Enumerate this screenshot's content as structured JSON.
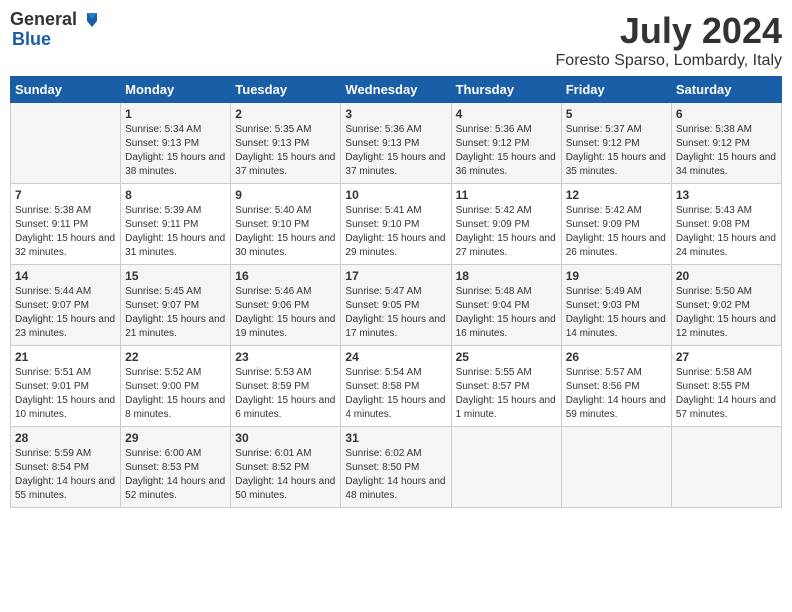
{
  "header": {
    "logo_general": "General",
    "logo_blue": "Blue",
    "month_title": "July 2024",
    "location": "Foresto Sparso, Lombardy, Italy"
  },
  "columns": [
    "Sunday",
    "Monday",
    "Tuesday",
    "Wednesday",
    "Thursday",
    "Friday",
    "Saturday"
  ],
  "weeks": [
    [
      {
        "day": "",
        "sunrise": "",
        "sunset": "",
        "daylight": ""
      },
      {
        "day": "1",
        "sunrise": "Sunrise: 5:34 AM",
        "sunset": "Sunset: 9:13 PM",
        "daylight": "Daylight: 15 hours and 38 minutes."
      },
      {
        "day": "2",
        "sunrise": "Sunrise: 5:35 AM",
        "sunset": "Sunset: 9:13 PM",
        "daylight": "Daylight: 15 hours and 37 minutes."
      },
      {
        "day": "3",
        "sunrise": "Sunrise: 5:36 AM",
        "sunset": "Sunset: 9:13 PM",
        "daylight": "Daylight: 15 hours and 37 minutes."
      },
      {
        "day": "4",
        "sunrise": "Sunrise: 5:36 AM",
        "sunset": "Sunset: 9:12 PM",
        "daylight": "Daylight: 15 hours and 36 minutes."
      },
      {
        "day": "5",
        "sunrise": "Sunrise: 5:37 AM",
        "sunset": "Sunset: 9:12 PM",
        "daylight": "Daylight: 15 hours and 35 minutes."
      },
      {
        "day": "6",
        "sunrise": "Sunrise: 5:38 AM",
        "sunset": "Sunset: 9:12 PM",
        "daylight": "Daylight: 15 hours and 34 minutes."
      }
    ],
    [
      {
        "day": "7",
        "sunrise": "Sunrise: 5:38 AM",
        "sunset": "Sunset: 9:11 PM",
        "daylight": "Daylight: 15 hours and 32 minutes."
      },
      {
        "day": "8",
        "sunrise": "Sunrise: 5:39 AM",
        "sunset": "Sunset: 9:11 PM",
        "daylight": "Daylight: 15 hours and 31 minutes."
      },
      {
        "day": "9",
        "sunrise": "Sunrise: 5:40 AM",
        "sunset": "Sunset: 9:10 PM",
        "daylight": "Daylight: 15 hours and 30 minutes."
      },
      {
        "day": "10",
        "sunrise": "Sunrise: 5:41 AM",
        "sunset": "Sunset: 9:10 PM",
        "daylight": "Daylight: 15 hours and 29 minutes."
      },
      {
        "day": "11",
        "sunrise": "Sunrise: 5:42 AM",
        "sunset": "Sunset: 9:09 PM",
        "daylight": "Daylight: 15 hours and 27 minutes."
      },
      {
        "day": "12",
        "sunrise": "Sunrise: 5:42 AM",
        "sunset": "Sunset: 9:09 PM",
        "daylight": "Daylight: 15 hours and 26 minutes."
      },
      {
        "day": "13",
        "sunrise": "Sunrise: 5:43 AM",
        "sunset": "Sunset: 9:08 PM",
        "daylight": "Daylight: 15 hours and 24 minutes."
      }
    ],
    [
      {
        "day": "14",
        "sunrise": "Sunrise: 5:44 AM",
        "sunset": "Sunset: 9:07 PM",
        "daylight": "Daylight: 15 hours and 23 minutes."
      },
      {
        "day": "15",
        "sunrise": "Sunrise: 5:45 AM",
        "sunset": "Sunset: 9:07 PM",
        "daylight": "Daylight: 15 hours and 21 minutes."
      },
      {
        "day": "16",
        "sunrise": "Sunrise: 5:46 AM",
        "sunset": "Sunset: 9:06 PM",
        "daylight": "Daylight: 15 hours and 19 minutes."
      },
      {
        "day": "17",
        "sunrise": "Sunrise: 5:47 AM",
        "sunset": "Sunset: 9:05 PM",
        "daylight": "Daylight: 15 hours and 17 minutes."
      },
      {
        "day": "18",
        "sunrise": "Sunrise: 5:48 AM",
        "sunset": "Sunset: 9:04 PM",
        "daylight": "Daylight: 15 hours and 16 minutes."
      },
      {
        "day": "19",
        "sunrise": "Sunrise: 5:49 AM",
        "sunset": "Sunset: 9:03 PM",
        "daylight": "Daylight: 15 hours and 14 minutes."
      },
      {
        "day": "20",
        "sunrise": "Sunrise: 5:50 AM",
        "sunset": "Sunset: 9:02 PM",
        "daylight": "Daylight: 15 hours and 12 minutes."
      }
    ],
    [
      {
        "day": "21",
        "sunrise": "Sunrise: 5:51 AM",
        "sunset": "Sunset: 9:01 PM",
        "daylight": "Daylight: 15 hours and 10 minutes."
      },
      {
        "day": "22",
        "sunrise": "Sunrise: 5:52 AM",
        "sunset": "Sunset: 9:00 PM",
        "daylight": "Daylight: 15 hours and 8 minutes."
      },
      {
        "day": "23",
        "sunrise": "Sunrise: 5:53 AM",
        "sunset": "Sunset: 8:59 PM",
        "daylight": "Daylight: 15 hours and 6 minutes."
      },
      {
        "day": "24",
        "sunrise": "Sunrise: 5:54 AM",
        "sunset": "Sunset: 8:58 PM",
        "daylight": "Daylight: 15 hours and 4 minutes."
      },
      {
        "day": "25",
        "sunrise": "Sunrise: 5:55 AM",
        "sunset": "Sunset: 8:57 PM",
        "daylight": "Daylight: 15 hours and 1 minute."
      },
      {
        "day": "26",
        "sunrise": "Sunrise: 5:57 AM",
        "sunset": "Sunset: 8:56 PM",
        "daylight": "Daylight: 14 hours and 59 minutes."
      },
      {
        "day": "27",
        "sunrise": "Sunrise: 5:58 AM",
        "sunset": "Sunset: 8:55 PM",
        "daylight": "Daylight: 14 hours and 57 minutes."
      }
    ],
    [
      {
        "day": "28",
        "sunrise": "Sunrise: 5:59 AM",
        "sunset": "Sunset: 8:54 PM",
        "daylight": "Daylight: 14 hours and 55 minutes."
      },
      {
        "day": "29",
        "sunrise": "Sunrise: 6:00 AM",
        "sunset": "Sunset: 8:53 PM",
        "daylight": "Daylight: 14 hours and 52 minutes."
      },
      {
        "day": "30",
        "sunrise": "Sunrise: 6:01 AM",
        "sunset": "Sunset: 8:52 PM",
        "daylight": "Daylight: 14 hours and 50 minutes."
      },
      {
        "day": "31",
        "sunrise": "Sunrise: 6:02 AM",
        "sunset": "Sunset: 8:50 PM",
        "daylight": "Daylight: 14 hours and 48 minutes."
      },
      {
        "day": "",
        "sunrise": "",
        "sunset": "",
        "daylight": ""
      },
      {
        "day": "",
        "sunrise": "",
        "sunset": "",
        "daylight": ""
      },
      {
        "day": "",
        "sunrise": "",
        "sunset": "",
        "daylight": ""
      }
    ]
  ]
}
